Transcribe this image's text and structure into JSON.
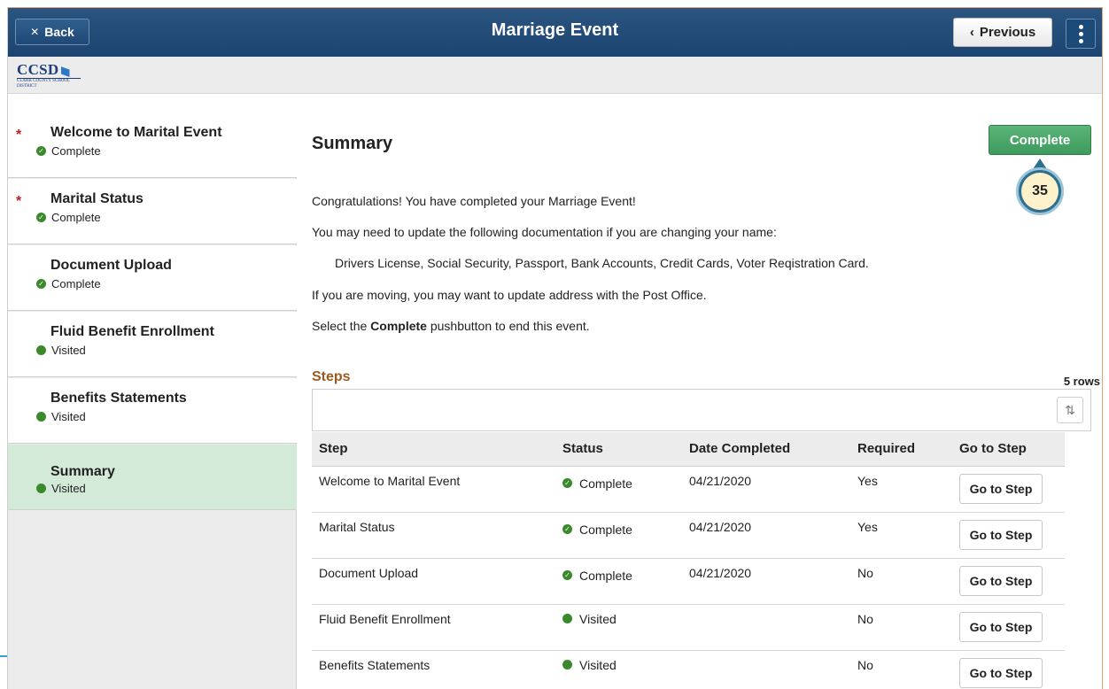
{
  "header": {
    "back_label": "Back",
    "title": "Marriage Event",
    "previous_label": "Previous"
  },
  "logo": {
    "name": "CCSD",
    "sub": "CLARK COUNTY SCHOOL DISTRICT"
  },
  "sidebar": {
    "items": [
      {
        "label": "Welcome to Marital Event",
        "status": "Complete",
        "required": true
      },
      {
        "label": "Marital Status",
        "status": "Complete",
        "required": true
      },
      {
        "label": "Document Upload",
        "status": "Complete",
        "required": false
      },
      {
        "label": "Fluid Benefit Enrollment",
        "status": "Visited",
        "required": false
      },
      {
        "label": "Benefits Statements",
        "status": "Visited",
        "required": false
      },
      {
        "label": "Summary",
        "status": "Visited",
        "required": false,
        "active": true
      }
    ]
  },
  "main": {
    "title": "Summary",
    "complete_label": "Complete",
    "callout_number": "35",
    "lines": {
      "congrats": "Congratulations! You have completed your Marriage Event!",
      "update_docs": "You may need to update the following documentation if you are changing your name:",
      "doc_list": "Drivers License, Social Security, Passport, Bank Accounts, Credit Cards, Voter Reqistration Card.",
      "moving": "If you are moving, you may want to update address with the Post Office.",
      "select_prefix": "Select the ",
      "select_bold": "Complete",
      "select_suffix": " pushbutton to end this event."
    },
    "steps": {
      "label": "Steps",
      "rows_count": "5 rows",
      "columns": [
        "Step",
        "Status",
        "Date Completed",
        "Required",
        "Go to Step"
      ],
      "rows": [
        {
          "step": "Welcome to Marital Event",
          "status": "Complete",
          "date": "04/21/2020",
          "required": "Yes",
          "button": "Go to Step"
        },
        {
          "step": "Marital Status",
          "status": "Complete",
          "date": "04/21/2020",
          "required": "Yes",
          "button": "Go to Step"
        },
        {
          "step": "Document Upload",
          "status": "Complete",
          "date": "04/21/2020",
          "required": "No",
          "button": "Go to Step"
        },
        {
          "step": "Fluid Benefit Enrollment",
          "status": "Visited",
          "date": "",
          "required": "No",
          "button": "Go to Step"
        },
        {
          "step": "Benefits Statements",
          "status": "Visited",
          "date": "",
          "required": "No",
          "button": "Go to Step"
        }
      ]
    }
  },
  "colors": {
    "header": "#1d4470",
    "complete_green": "#3e9a5d",
    "status_green": "#3a8a2c",
    "active_item": "#d3ead9",
    "required_star": "#c0202a",
    "steps_label": "#9c5a21"
  }
}
